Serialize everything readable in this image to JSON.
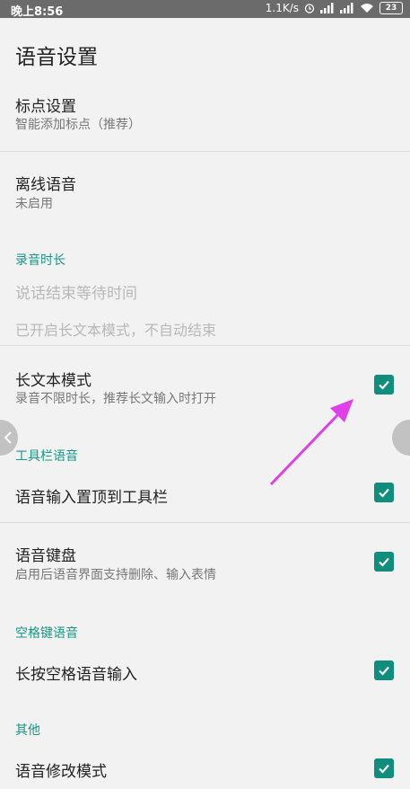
{
  "status_bar": {
    "time": "晚上8:56",
    "network_speed": "1.1K/s",
    "battery": "23"
  },
  "header": {
    "title": "语音设置"
  },
  "items": {
    "punctuation": {
      "title": "标点设置",
      "subtitle": "智能添加标点（推荐）"
    },
    "offline": {
      "title": "离线语音",
      "subtitle": "未启用"
    },
    "recording_section": "录音时长",
    "wait_time": {
      "title": "说话结束等待时间",
      "subtitle": "已开启长文本模式，不自动结束"
    },
    "long_text": {
      "title": "长文本模式",
      "subtitle": "录音不限时长，推荐长文输入时打开",
      "checked": true
    },
    "toolbar_section": "工具栏语音",
    "toolbar_top": {
      "title": "语音输入置顶到工具栏",
      "checked": true
    },
    "voice_keyboard": {
      "title": "语音键盘",
      "subtitle": "启用后语音界面支持删除、输入表情",
      "checked": true
    },
    "space_section": "空格键语音",
    "space_long_press": {
      "title": "长按空格语音输入",
      "checked": true
    },
    "other_section": "其他",
    "voice_edit": {
      "title": "语音修改模式",
      "checked": true
    }
  },
  "colors": {
    "accent": "#159a87",
    "checkbox": "#0f8e7d",
    "annotation_arrow": "#e040e8"
  },
  "icons": [
    "signal-icon",
    "wifi-icon",
    "alarm-icon",
    "battery-icon",
    "check-icon",
    "chevron-left-icon"
  ]
}
